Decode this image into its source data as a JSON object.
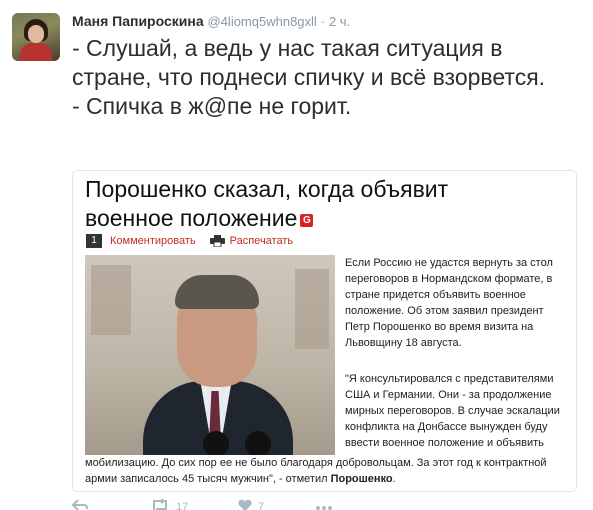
{
  "tweet": {
    "author_name": "Маня Папироскина",
    "author_handle": "@4liomq5whn8gxll",
    "separator": "·",
    "time": "2 ч.",
    "text_lines": [
      "- Слушай, а ведь у нас такая ситуация в стране, что поднеси спичку и всё взорвется.",
      "- Спичка в ж@пе не горит."
    ]
  },
  "card": {
    "title": "Порошенко сказал, когда объявит военное положение",
    "badge": "G",
    "comment_count": "1",
    "comment_label": "Комментировать",
    "print_label": "Распечатать",
    "paragraph1": "Если Россию не удастся вернуть за стол переговоров в Нормандском формате, в стране придется объявить военное положение. Об этом заявил президент Петр Порошенко во время визита на Львовщину 18 августа.",
    "quote_top": "\"Я консультировался с представителями США и Германии. Они - за продолжение мирных переговоров. В случае эскалации конфликта на Донбассе вынужден буду ввести военное положение и объявить",
    "quote_bottom": "мобилизацию. До сих пор ее не было благодаря добровольцам. За этот год к контрактной армии записалось 45 тысяч мужчин\", - отметил",
    "quote_bold_name": "Порошенко",
    "quote_end": "."
  },
  "actions": {
    "retweet_count": "17",
    "like_count": "7",
    "icons": [
      "reply-icon",
      "retweet-icon",
      "like-icon",
      "more-icon"
    ]
  },
  "colors": {
    "link_red": "#c22b25",
    "muted": "#8899a6",
    "border": "#e1e8ed"
  }
}
